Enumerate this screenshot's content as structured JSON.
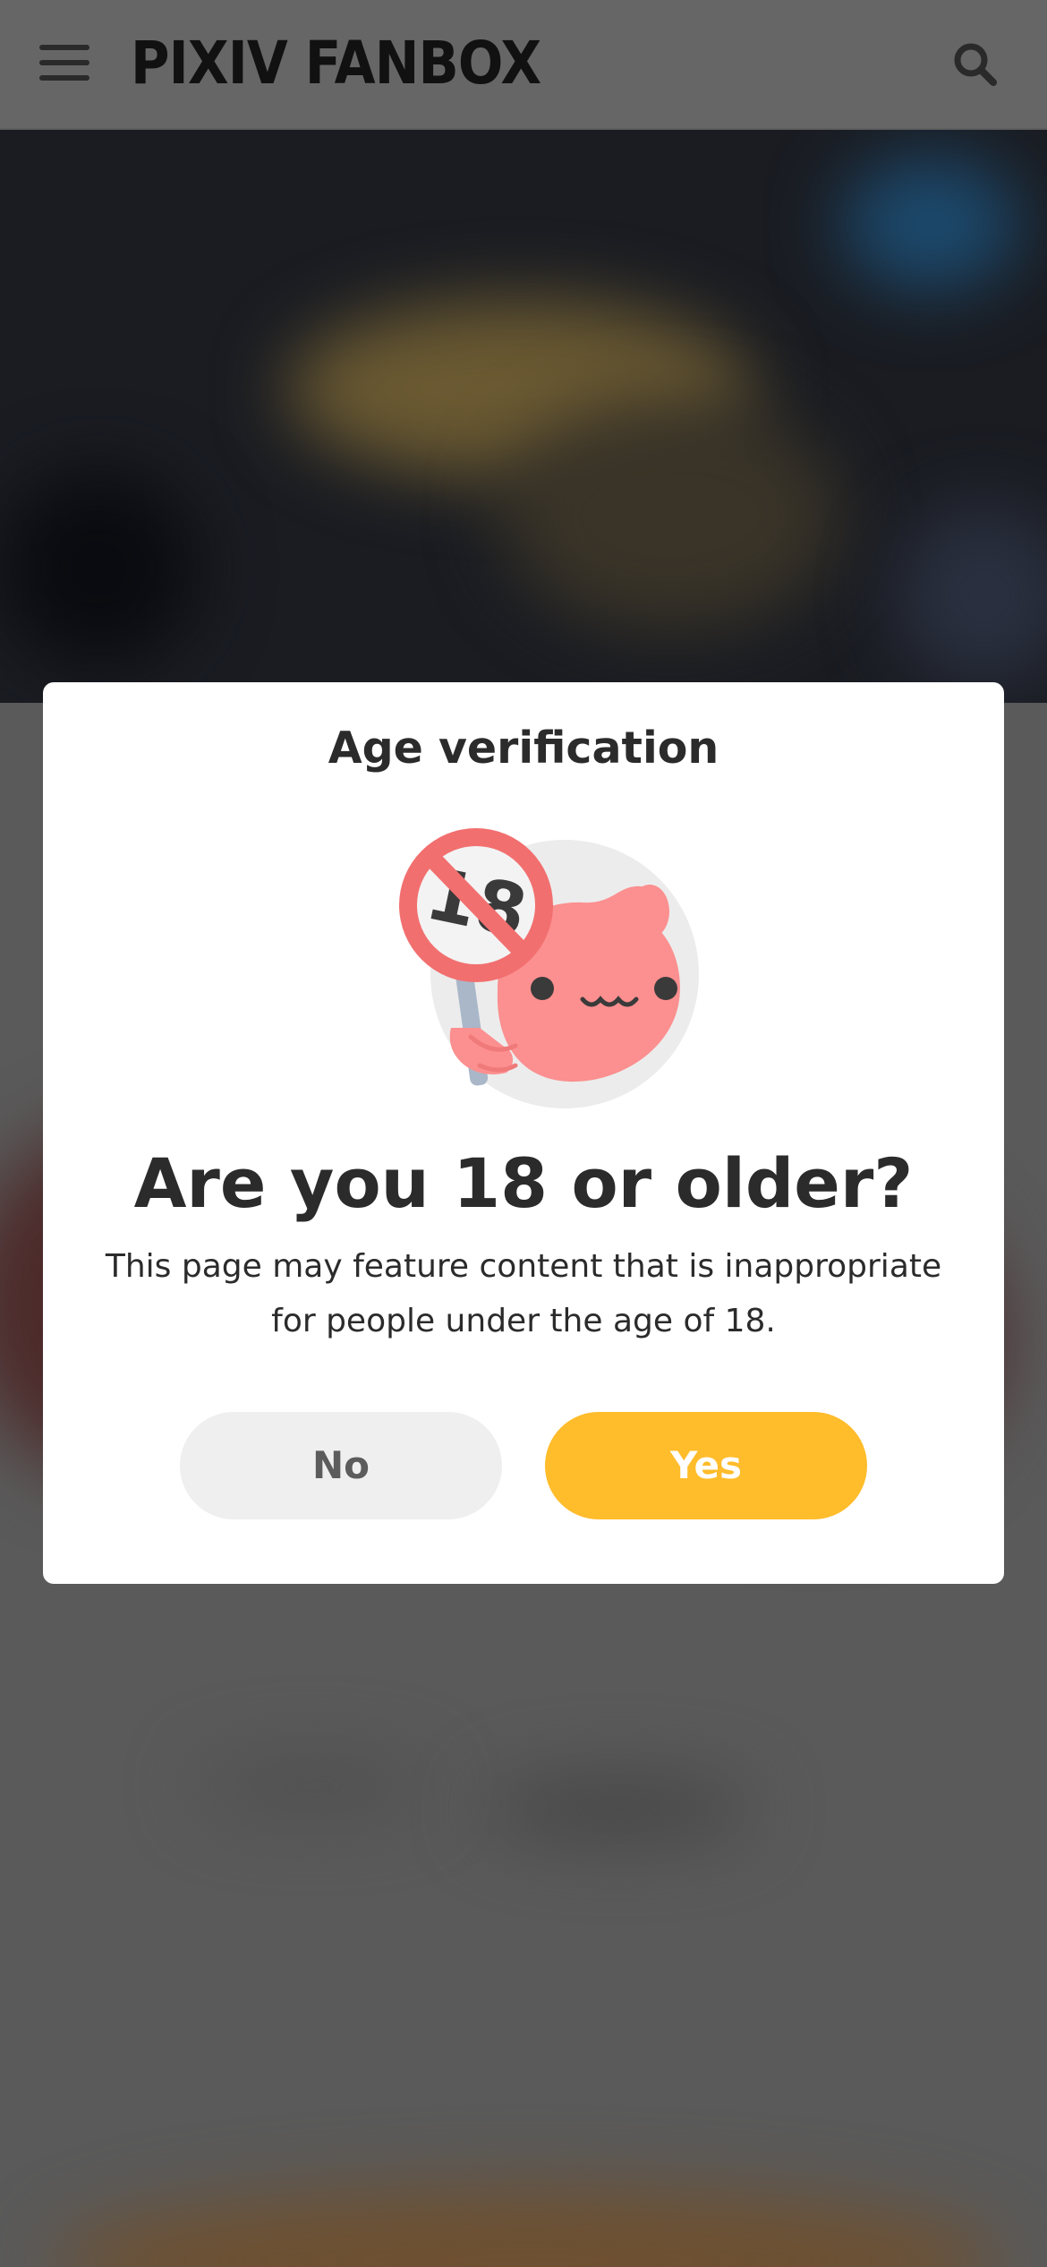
{
  "header": {
    "logo_text": "PIXIV FANBOX",
    "menu_icon": "hamburger-menu-icon",
    "search_icon": "search-icon"
  },
  "modal": {
    "title": "Age verification",
    "illustration": "age-restriction-18-mascot-illustration",
    "illustration_sign_text": "18",
    "question": "Are you 18 or older?",
    "description": "This page may feature content that is inappropriate for people under the age of 18.",
    "no_label": "No",
    "yes_label": "Yes"
  },
  "colors": {
    "yes_button": "#ffbc2b",
    "no_button": "#efefef",
    "overlay": "#5a5a5a",
    "mascot_pink": "#fc8f8f",
    "prohibition_red": "#f26f6f"
  }
}
